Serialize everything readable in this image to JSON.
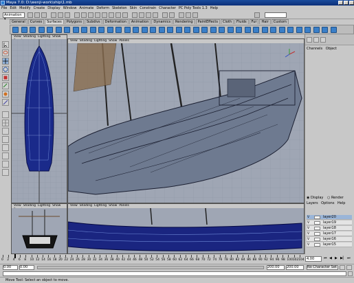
{
  "window": {
    "title": "Maya 7.0: D:\\wenji-work\\ship\\1.mb"
  },
  "menubar": [
    "File",
    "Edit",
    "Modify",
    "Create",
    "Display",
    "Window",
    "Animate",
    "Deform",
    "Skeleton",
    "Skin",
    "Constrain",
    "Character",
    "PC Poly Tools 1.3",
    "Help"
  ],
  "statusline": {
    "mode": "Animation"
  },
  "shelf": {
    "tabs": [
      "General",
      "Curves",
      "Surfaces",
      "Polygons",
      "Subdivs",
      "Deformation",
      "Animation",
      "Dynamics",
      "Rendering",
      "PaintEffects",
      "Cloth",
      "Fluids",
      "Fur",
      "Hair",
      "Custom"
    ],
    "active_tab": "Surfaces"
  },
  "panels": {
    "menu": [
      "View",
      "Shading",
      "Lighting",
      "Show",
      "Panels"
    ]
  },
  "channelbox": {
    "tabs": [
      "Channels",
      "Object"
    ]
  },
  "layers": {
    "mode": [
      "Display",
      "Render"
    ],
    "menu": [
      "Layers",
      "Options",
      "Help"
    ],
    "items": [
      {
        "name": "layer20",
        "visible": "V",
        "selected": true
      },
      {
        "name": "layer19",
        "visible": "V",
        "selected": false
      },
      {
        "name": "layer18",
        "visible": "V",
        "selected": false
      },
      {
        "name": "layer17",
        "visible": "V",
        "selected": false
      },
      {
        "name": "layer16",
        "visible": "V",
        "selected": false
      },
      {
        "name": "layer15",
        "visible": "V",
        "selected": false
      }
    ]
  },
  "timeslider": {
    "ticks": [
      "0",
      "2",
      "4",
      "6",
      "8",
      "10",
      "12",
      "14",
      "16",
      "18",
      "20",
      "22",
      "24",
      "26",
      "28",
      "30",
      "32",
      "34",
      "36",
      "38",
      "40",
      "42",
      "44",
      "46",
      "48",
      "50",
      "52",
      "54",
      "56",
      "58",
      "60",
      "62",
      "64",
      "66",
      "68",
      "70",
      "72",
      "74",
      "76",
      "78",
      "80",
      "82",
      "84",
      "86",
      "88",
      "90",
      "92",
      "94",
      "96",
      "98",
      "100",
      "102",
      "104"
    ],
    "current_frame": "4.00"
  },
  "rangeslider": {
    "start": "0.00",
    "start2": "0.00",
    "end": "200.00",
    "end2": "200.00",
    "character": "No Character Set"
  },
  "helpline": {
    "text": "Move Tool: Select an object to move."
  }
}
